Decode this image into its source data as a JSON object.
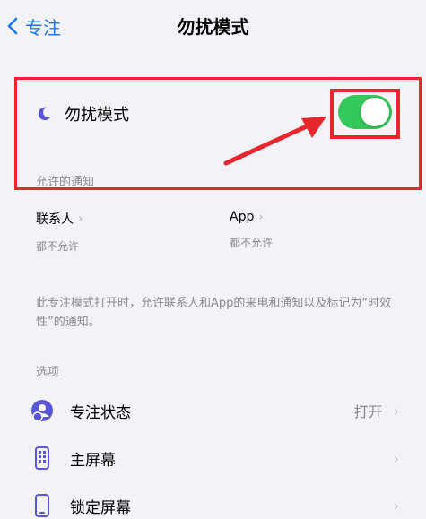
{
  "nav": {
    "back_label": "专注",
    "title": "勿扰模式"
  },
  "dnd": {
    "label": "勿扰模式",
    "enabled": true
  },
  "allowed": {
    "section_label": "允许的通知",
    "contacts": {
      "title": "联系人",
      "value": "都不允许"
    },
    "apps": {
      "title": "App",
      "value": "都不允许"
    }
  },
  "description": "此专注模式打开时，允许联系人和App的来电和通知以及标记为“时效性”的通知。",
  "options": {
    "section_label": "选项",
    "items": [
      {
        "label": "专注状态",
        "value": "打开"
      },
      {
        "label": "主屏幕",
        "value": ""
      },
      {
        "label": "锁定屏幕",
        "value": ""
      }
    ]
  },
  "colors": {
    "accent": "#1a7cf5",
    "toggle_on": "#34c759",
    "annotation": "#e8262e",
    "moon": "#5856d6"
  }
}
